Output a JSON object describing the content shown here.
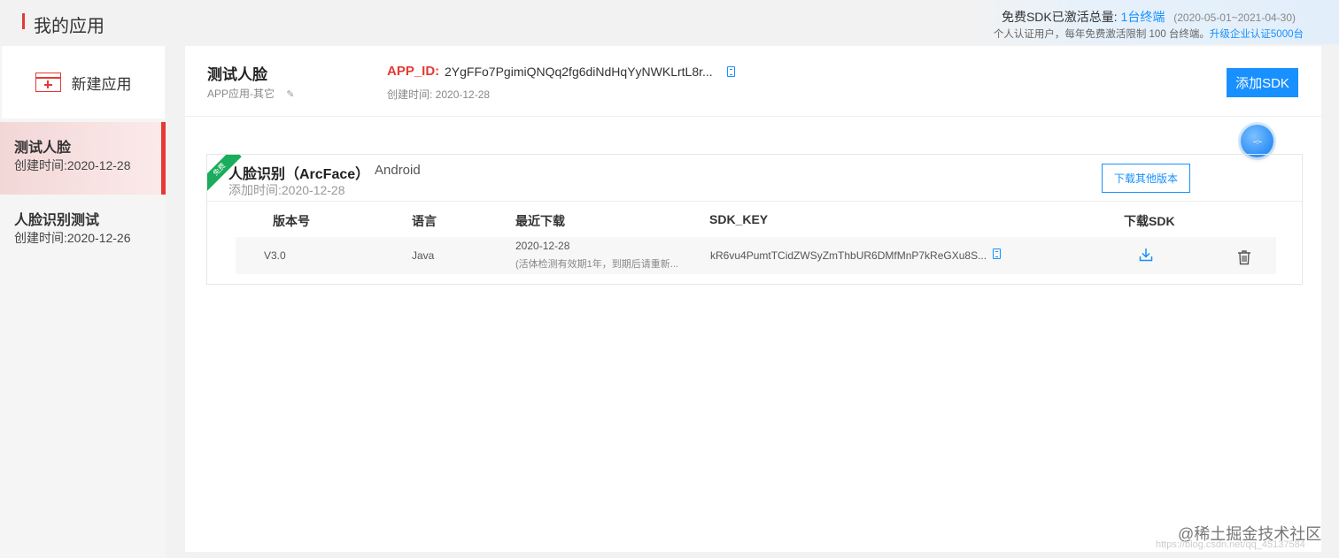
{
  "header": {
    "title": "我的应用",
    "quota": {
      "label": "免费SDK已激活总量:",
      "count": "1台终端",
      "range": "(2020-05-01~2021-04-30)",
      "note": "个人认证用户，每年免费激活限制 100 台终端。",
      "upgrade": "升级企业认证5000台"
    }
  },
  "sidebar": {
    "new_app_label": "新建应用",
    "apps": [
      {
        "name": "测试人脸",
        "date": "创建时间:2020-12-28",
        "active": true
      },
      {
        "name": "人脸识别测试",
        "date": "创建时间:2020-12-26",
        "active": false
      }
    ]
  },
  "app": {
    "name": "测试人脸",
    "type": "APP应用-其它",
    "appid_label": "APP_ID:",
    "appid_value": "2YgFFo7PgimiQNQq2fg6diNdHqYyNWKLrtL8r...",
    "created": "创建时间: 2020-12-28",
    "add_sdk_label": "添加SDK"
  },
  "float_ball_label": "--:--",
  "sdk": {
    "ribbon": "免费",
    "name": "人脸识别（ArcFace）",
    "platform": "Android",
    "added": "添加时间:2020-12-28",
    "download_other_label": "下载其他版本",
    "columns": [
      "版本号",
      "语言",
      "最近下载",
      "SDK_KEY",
      "下载SDK"
    ],
    "rows": [
      {
        "version": "V3.0",
        "language": "Java",
        "last_download": "2020-12-28",
        "note": "(活体检测有效期1年，到期后请重新...",
        "sdk_key": "kR6vu4PumtTCidZWSyZmThbUR6DMfMnP7kReGXu8S..."
      }
    ]
  },
  "watermark": "@稀土掘金技术社区",
  "watermark_small": "https://blog.csdn.net/qq_45137584",
  "colors": {
    "accent": "#1890ff",
    "brand_red": "#e53935",
    "ribbon_green": "#1aad5c"
  },
  "icons": [
    "new-app-icon",
    "edit-icon",
    "copy-icon",
    "download-icon",
    "trash-icon"
  ]
}
